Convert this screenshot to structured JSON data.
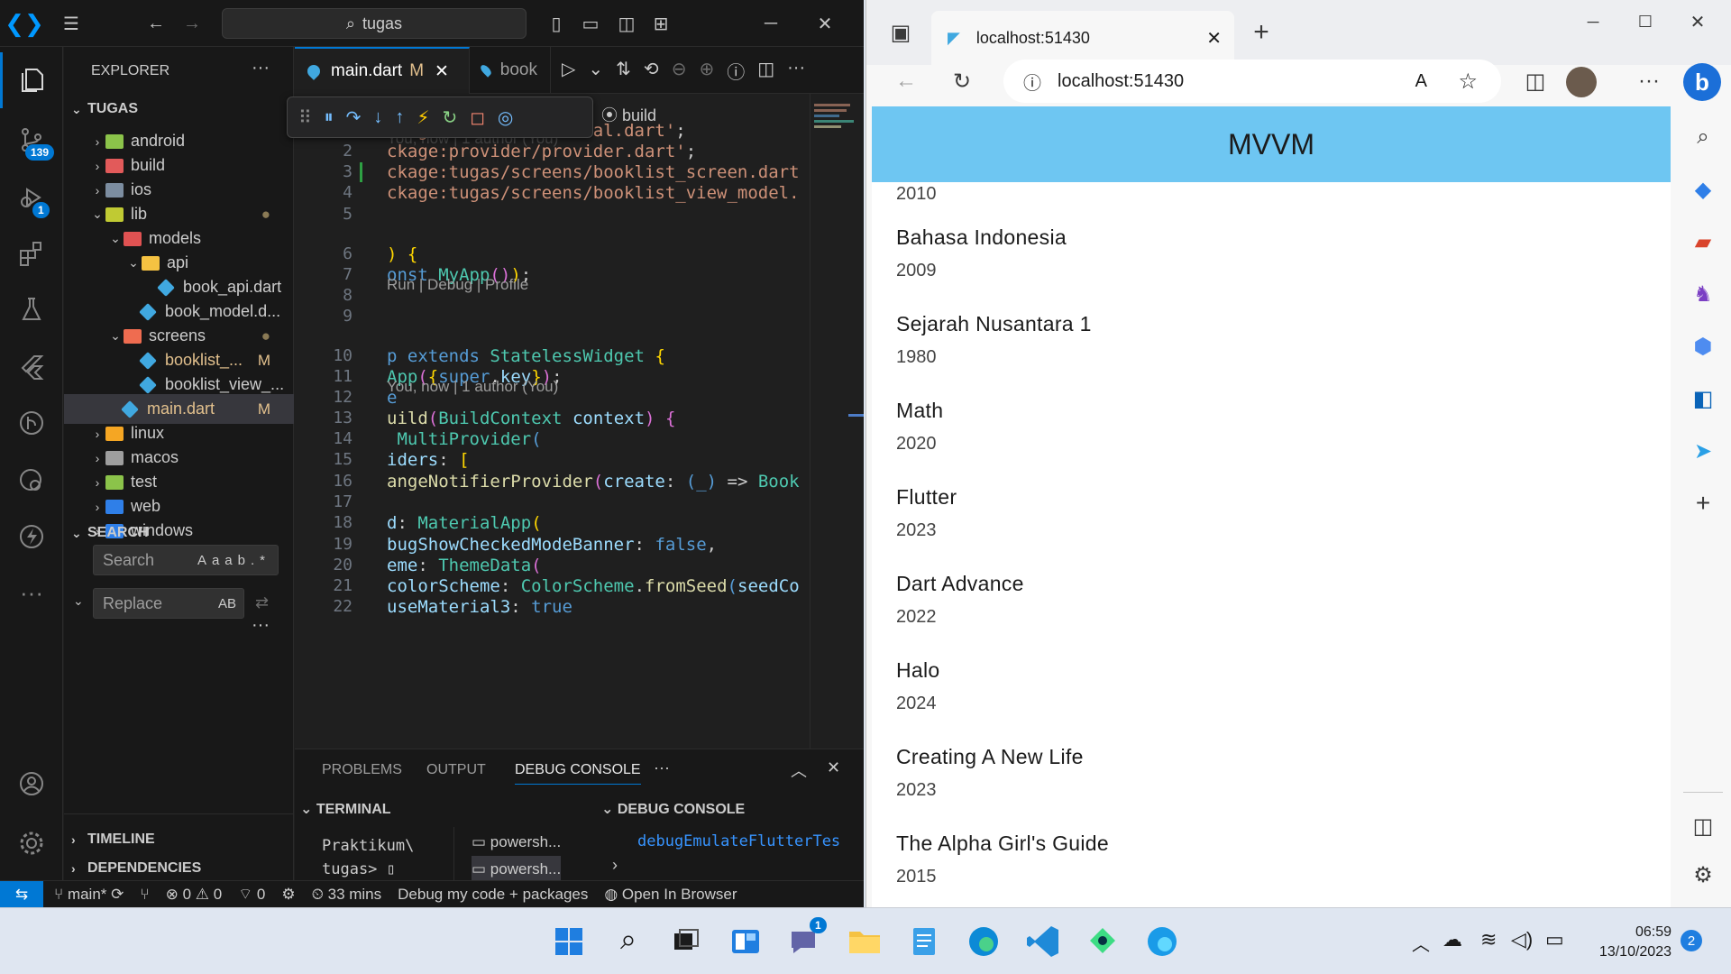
{
  "vscode": {
    "search_text": "tugas",
    "activity_badges": {
      "source_control": "139",
      "debug": "1"
    },
    "explorer_title": "EXPLORER",
    "workspace": "TUGAS",
    "tree": [
      {
        "label": "android",
        "indent": 1,
        "chev": "›",
        "icon": "folder-android-icon",
        "mark": ""
      },
      {
        "label": "build",
        "indent": 1,
        "chev": "›",
        "icon": "folder-build-icon",
        "mark": ""
      },
      {
        "label": "ios",
        "indent": 1,
        "chev": "›",
        "icon": "folder-ios-icon",
        "mark": ""
      },
      {
        "label": "lib",
        "indent": 1,
        "chev": "⌄",
        "icon": "folder-lib-icon",
        "mark": "●"
      },
      {
        "label": "models",
        "indent": 2,
        "chev": "⌄",
        "icon": "folder-models-icon",
        "mark": ""
      },
      {
        "label": "api",
        "indent": 3,
        "chev": "⌄",
        "icon": "folder-api-icon",
        "mark": ""
      },
      {
        "label": "book_api.dart",
        "indent": 4,
        "chev": "",
        "icon": "dart-file-icon",
        "mark": ""
      },
      {
        "label": "book_model.d...",
        "indent": 3,
        "chev": "",
        "icon": "dart-file-icon",
        "mark": ""
      },
      {
        "label": "screens",
        "indent": 2,
        "chev": "⌄",
        "icon": "folder-screens-icon",
        "mark": "●"
      },
      {
        "label": "booklist_...",
        "indent": 3,
        "chev": "",
        "icon": "dart-file-icon",
        "mark": "M"
      },
      {
        "label": "booklist_view_...",
        "indent": 3,
        "chev": "",
        "icon": "dart-file-icon",
        "mark": ""
      },
      {
        "label": "main.dart",
        "indent": 2,
        "chev": "",
        "icon": "dart-file-icon",
        "mark": "M",
        "active": true
      },
      {
        "label": "linux",
        "indent": 1,
        "chev": "›",
        "icon": "folder-linux-icon",
        "mark": ""
      },
      {
        "label": "macos",
        "indent": 1,
        "chev": "›",
        "icon": "folder-macos-icon",
        "mark": ""
      },
      {
        "label": "test",
        "indent": 1,
        "chev": "›",
        "icon": "folder-test-icon",
        "mark": ""
      },
      {
        "label": "web",
        "indent": 1,
        "chev": "›",
        "icon": "folder-web-icon",
        "mark": ""
      },
      {
        "label": "windows",
        "indent": 1,
        "chev": "›",
        "icon": "folder-windows-icon",
        "mark": ""
      }
    ],
    "search_section": "SEARCH",
    "search_placeholder": "Search",
    "replace_placeholder": "Replace",
    "search_opts": [
      "Aa",
      "ab",
      ".*"
    ],
    "replace_opt": "AB",
    "timeline": "TIMELINE",
    "dependencies": "DEPENDENCIES",
    "tabs": [
      {
        "label": "main.dart",
        "mark": "M",
        "active": true
      },
      {
        "label": "book",
        "mark": "",
        "active": false
      }
    ],
    "breadcrumb_tail": "build",
    "codelens_top": "You, now | 1 author (You)",
    "codelens_run": "Run | Debug | Profile",
    "codelens_author": "You, now | 1 author (You)",
    "code_lines": [
      {
        "n": "1",
        "html": "<span class=\"s\">ckage:flutter/material.dart'</span>;"
      },
      {
        "n": "2",
        "html": "<span class=\"s\">ckage:provider/provider.dart'</span>;"
      },
      {
        "n": "3",
        "html": "<span class=\"s\">ckage:tugas/screens/booklist_screen.dart</span>"
      },
      {
        "n": "4",
        "html": "<span class=\"s\">ckage:tugas/screens/booklist_view_model.</span>"
      },
      {
        "n": "5",
        "html": ""
      },
      {
        "n": "6",
        "html": "<span class=\"y\">)</span> <span class=\"y\">{</span>"
      },
      {
        "n": "7",
        "html": "<span class=\"k\">onst</span> <span class=\"t\">MyApp</span><span class=\"p\">()</span><span class=\"y\">)</span>;"
      },
      {
        "n": "8",
        "html": ""
      },
      {
        "n": "9",
        "html": ""
      },
      {
        "n": "10",
        "html": "<span class=\"k\">p extends</span> <span class=\"t\">StatelessWidget</span> <span class=\"y\">{</span>"
      },
      {
        "n": "11",
        "html": "<span class=\"t\">App</span><span class=\"p\">(</span><span class=\"y\">{</span><span class=\"k\">super</span>.<span class=\"v\">key</span><span class=\"y\">}</span><span class=\"p\">)</span>;"
      },
      {
        "n": "12",
        "html": "<span class=\"k\">e</span>"
      },
      {
        "n": "13",
        "html": "<span class=\"f\">uild</span><span class=\"p\">(</span><span class=\"t\">BuildContext</span> <span class=\"v\">context</span><span class=\"p\">)</span> <span class=\"p\">{</span>"
      },
      {
        "n": "14",
        "html": " <span class=\"t\">MultiProvider</span><span class=\"k\">(</span>"
      },
      {
        "n": "15",
        "html": "<span class=\"v\">iders</span>: <span class=\"y\">[</span>"
      },
      {
        "n": "16",
        "html": "<span class=\"f\">angeNotifierProvider</span><span class=\"p\">(</span><span class=\"v\">create</span>: <span class=\"k\">(_)</span> => <span class=\"t\">Book</span>"
      },
      {
        "n": "17",
        "html": ""
      },
      {
        "n": "18",
        "html": "<span class=\"v\">d</span>: <span class=\"t\">MaterialApp</span><span class=\"y\">(</span>"
      },
      {
        "n": "19",
        "html": "<span class=\"v\">bugShowCheckedModeBanner</span>: <span class=\"k\">false</span>,"
      },
      {
        "n": "20",
        "html": "<span class=\"v\">eme</span>: <span class=\"t\">ThemeData</span><span class=\"p\">(</span>"
      },
      {
        "n": "21",
        "html": "<span class=\"v\">colorScheme</span>: <span class=\"t\">ColorScheme</span>.<span class=\"f\">fromSeed</span><span class=\"k\">(</span><span class=\"v\">seedCo</span>"
      },
      {
        "n": "22",
        "html": "<span class=\"v\">useMaterial3</span>: <span class=\"k\">true</span>"
      }
    ],
    "panel_tabs": [
      "PROBLEMS",
      "OUTPUT",
      "DEBUG CONSOLE"
    ],
    "terminal_label": "TERMINAL",
    "debug_console_label": "DEBUG CONSOLE",
    "terminal_lines": [
      "Praktikum\\",
      "tugas> ▯"
    ],
    "terminal_sessions": [
      "powersh...",
      "powersh..."
    ],
    "debug_console_text": "debugEmulateFlutterTes",
    "status": {
      "branch": "main*",
      "errors": "0",
      "warnings": "0",
      "ports": "0",
      "time": "33 mins",
      "debug_mode": "Debug my code + packages",
      "open_browser": "Open In Browser"
    }
  },
  "browser": {
    "tab_title": "localhost:51430",
    "address": "localhost:51430",
    "app_title": "MVVM",
    "partial_year": "2010",
    "books": [
      {
        "title": "Bahasa Indonesia",
        "year": "2009"
      },
      {
        "title": "Sejarah Nusantara 1",
        "year": "1980"
      },
      {
        "title": "Math",
        "year": "2020"
      },
      {
        "title": "Flutter",
        "year": "2023"
      },
      {
        "title": "Dart Advance",
        "year": "2022"
      },
      {
        "title": "Halo",
        "year": "2024"
      },
      {
        "title": "Creating A New Life",
        "year": "2023"
      },
      {
        "title": "The Alpha Girl's Guide",
        "year": "2015"
      }
    ]
  },
  "taskbar": {
    "time": "06:59",
    "date": "13/10/2023",
    "notification_count": "2",
    "teams_badge": "1"
  },
  "colors": {
    "appbar": "#6ec6f2",
    "vscode_bg": "#1f1f1f",
    "accent": "#0078d4"
  }
}
